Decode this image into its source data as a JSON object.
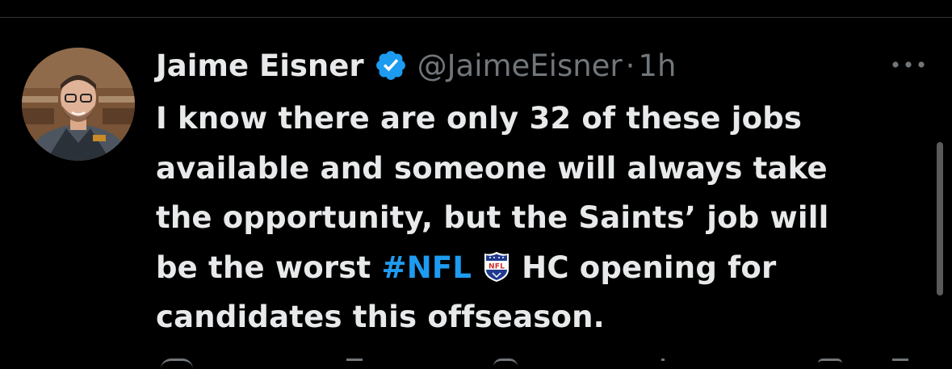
{
  "tweet": {
    "author_name": "Jaime Eisner",
    "handle": "@JaimeEisner",
    "separator": "·",
    "time": "1h",
    "verified": true,
    "lines": [
      "I know there are only 32 of these jobs",
      "available and someone will always take",
      "the opportunity, but the Saints’ job will"
    ],
    "line4_before": "be the worst",
    "hashtag": "#NFL",
    "line4_after": "HC opening for",
    "line5": "candidates this offseason."
  },
  "icons": {
    "verified": "verified-badge-icon",
    "more": "more-options-icon",
    "emoji": "nfl-shield-emoji"
  },
  "colors": {
    "background": "#000000",
    "text": "#e7e9ea",
    "secondary": "#71767b",
    "accent": "#1d9bf0"
  }
}
